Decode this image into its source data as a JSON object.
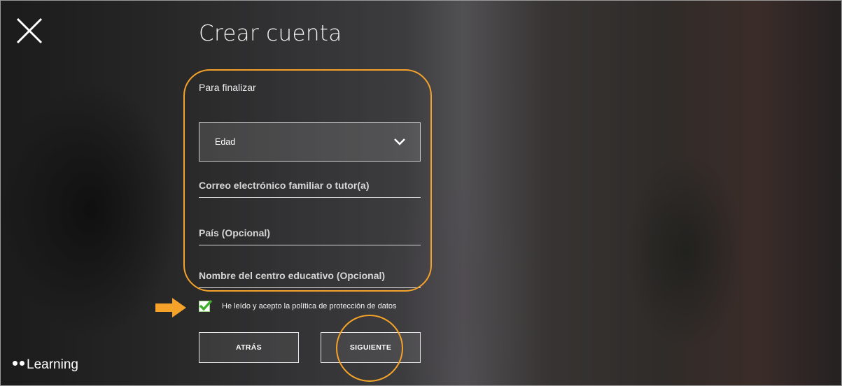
{
  "header": {
    "title": "Crear cuenta",
    "close_icon": "close-icon"
  },
  "form": {
    "subtitle": "Para finalizar",
    "age_select": {
      "selected": "Edad",
      "icon": "chevron-down-icon"
    },
    "fields": {
      "guardian_email": "Correo electrónico familiar o tutor(a)",
      "country": "País (Opcional)",
      "school": "Nombre del centro educativo (Opcional)"
    },
    "consent": {
      "label": "He leído y acepto la política de protección de datos",
      "checked": true
    }
  },
  "buttons": {
    "back": "ATRÁS",
    "next": "SIGUIENTE"
  },
  "brand": {
    "name": "Learning"
  },
  "colors": {
    "annotation": "#f5a22a",
    "checkmark": "#3fae2a"
  }
}
